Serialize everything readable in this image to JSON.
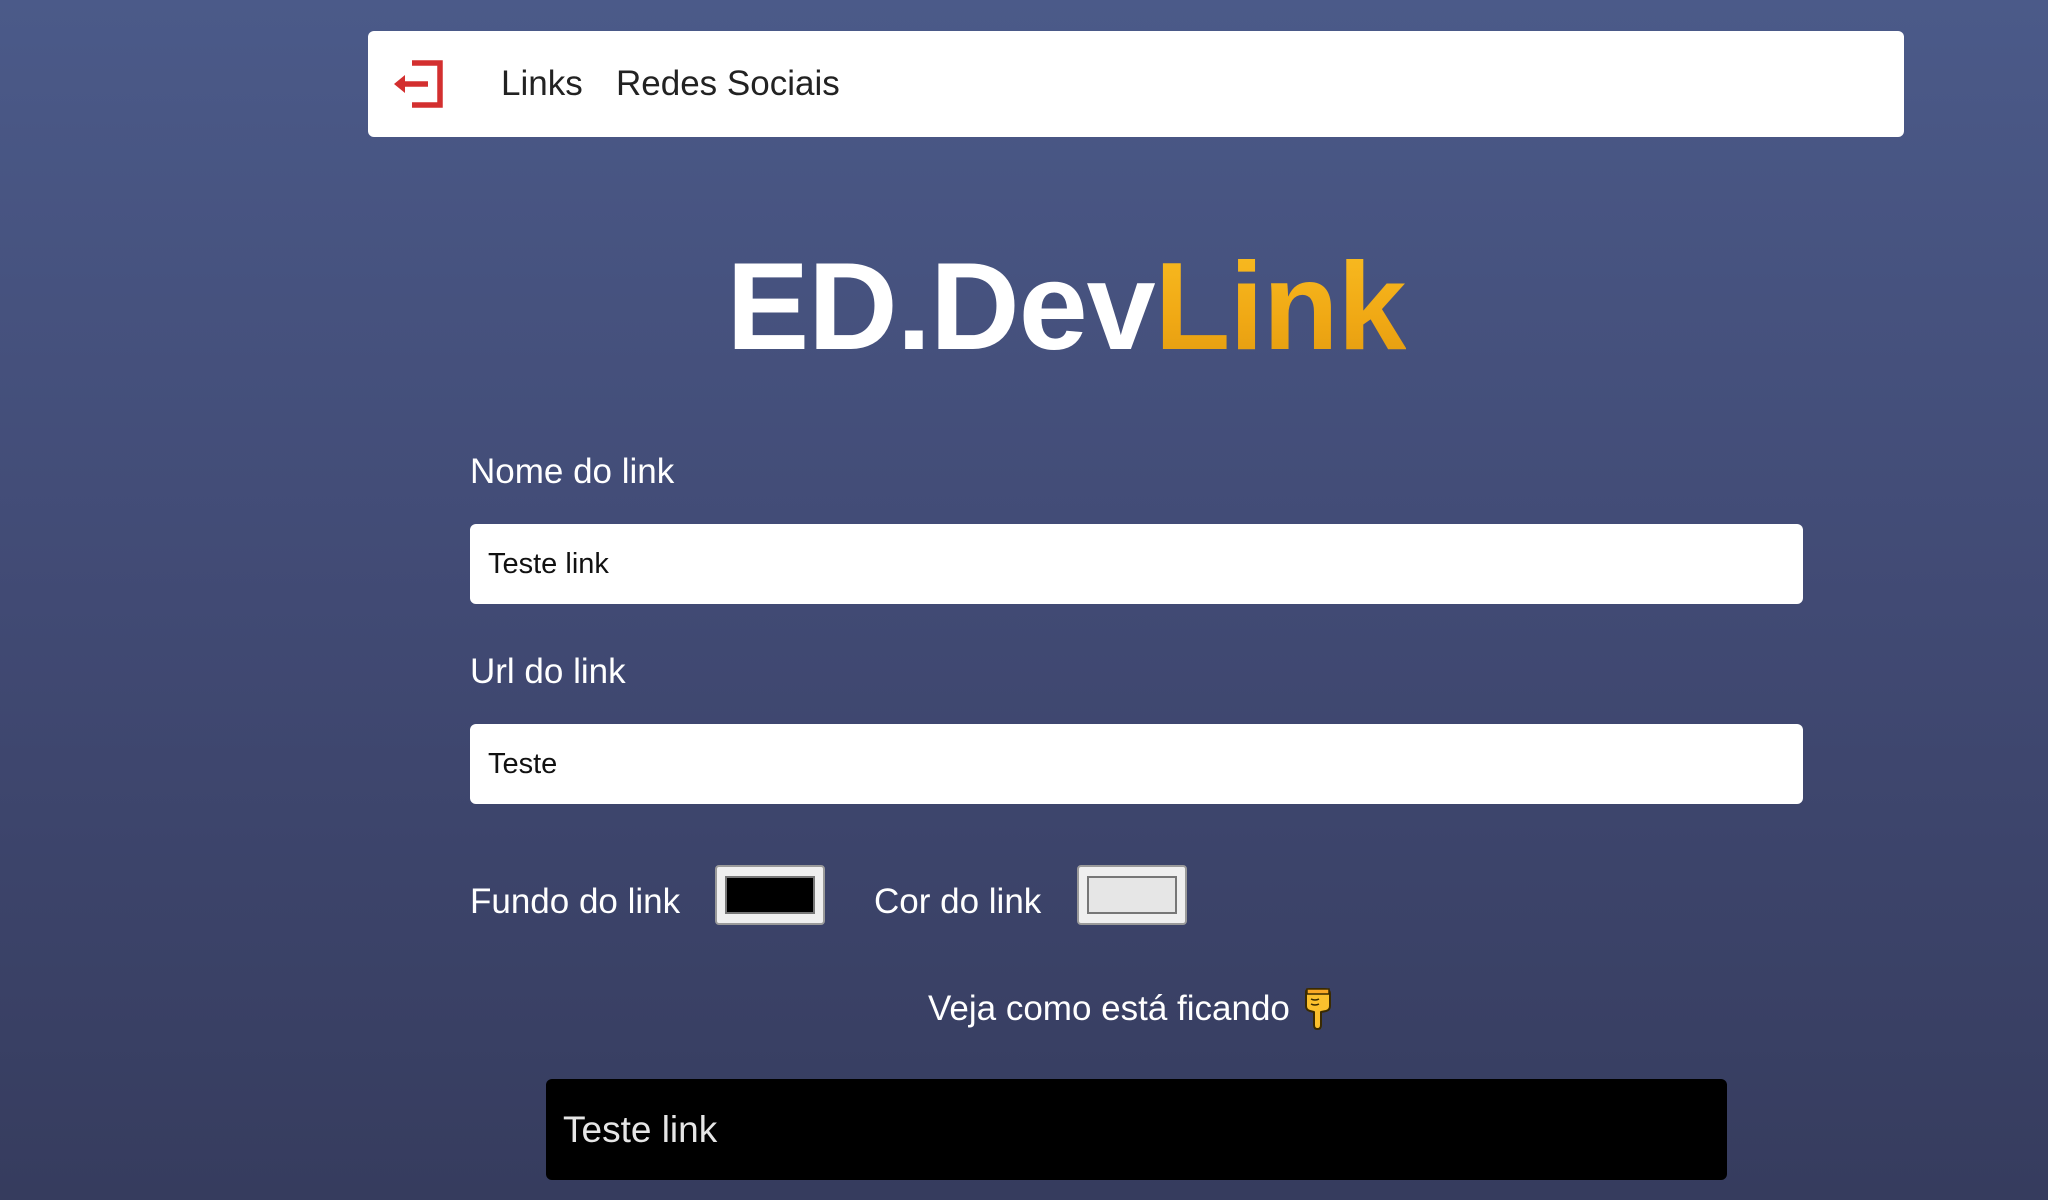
{
  "header": {
    "nav": [
      {
        "label": "Links"
      },
      {
        "label": "Redes Sociais"
      }
    ],
    "logout_icon": "logout-icon",
    "accent_color": "#d32f2f"
  },
  "logo": {
    "part1": "ED.Dev",
    "part2": "Link",
    "part1_color": "#ffffff",
    "part2_color": "#f5b21a"
  },
  "form": {
    "name_label": "Nome do link",
    "name_value": "Teste link",
    "url_label": "Url do link",
    "url_value": "Teste",
    "bg_label": "Fundo do link",
    "bg_color": "#000000",
    "fg_label": "Cor do link",
    "fg_color": "#e6e6e6"
  },
  "preview": {
    "title": "Veja como está ficando",
    "title_icon": "pointing-down-hand-icon",
    "link_text": "Teste link"
  }
}
